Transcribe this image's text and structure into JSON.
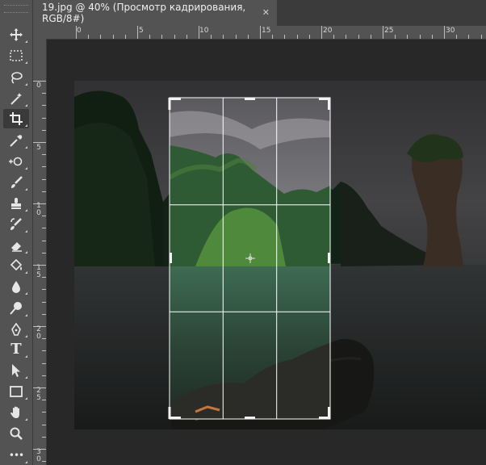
{
  "document_tab": {
    "title": "19.jpg @ 40% (Просмотр кадрирования, RGB/8#)",
    "close_glyph": "✕"
  },
  "ruler_top": {
    "labels": [
      "0",
      "5",
      "10",
      "15",
      "20",
      "25",
      "30"
    ]
  },
  "ruler_left": {
    "labels": [
      "0",
      "5",
      "1\n0",
      "1\n5",
      "2\n0",
      "2\n5",
      "3\n0"
    ]
  },
  "toolbar": {
    "tools": [
      {
        "name": "move-tool",
        "icon": "move-icon"
      },
      {
        "name": "marquee-tool",
        "icon": "rect-marquee-icon"
      },
      {
        "name": "lasso-tool",
        "icon": "lasso-icon"
      },
      {
        "name": "magic-wand-tool",
        "icon": "magic-wand-icon"
      },
      {
        "name": "crop-tool",
        "icon": "crop-icon",
        "active": true
      },
      {
        "name": "eyedropper-tool",
        "icon": "eyedropper-icon"
      },
      {
        "name": "spot-healing-tool",
        "icon": "healing-icon"
      },
      {
        "name": "brush-tool",
        "icon": "brush-icon"
      },
      {
        "name": "clone-stamp-tool",
        "icon": "stamp-icon"
      },
      {
        "name": "history-brush-tool",
        "icon": "history-brush-icon"
      },
      {
        "name": "eraser-tool",
        "icon": "eraser-icon"
      },
      {
        "name": "paint-bucket-tool",
        "icon": "bucket-icon"
      },
      {
        "name": "blur-tool",
        "icon": "drop-icon"
      },
      {
        "name": "dodge-tool",
        "icon": "dodge-icon"
      },
      {
        "name": "pen-tool",
        "icon": "pen-icon"
      },
      {
        "name": "type-tool",
        "icon": "type-icon",
        "glyph": "T"
      },
      {
        "name": "path-selection-tool",
        "icon": "arrow-icon"
      },
      {
        "name": "rectangle-tool",
        "icon": "rectangle-icon"
      },
      {
        "name": "hand-tool",
        "icon": "hand-icon"
      },
      {
        "name": "zoom-tool",
        "icon": "zoom-icon"
      },
      {
        "name": "more-tools",
        "icon": "more-icon",
        "glyph": "•••"
      }
    ]
  },
  "colors": {
    "workspace": "#282828",
    "panel": "#535353",
    "tabbar": "#3b3b3b",
    "crop_frame": "#ffffff"
  }
}
